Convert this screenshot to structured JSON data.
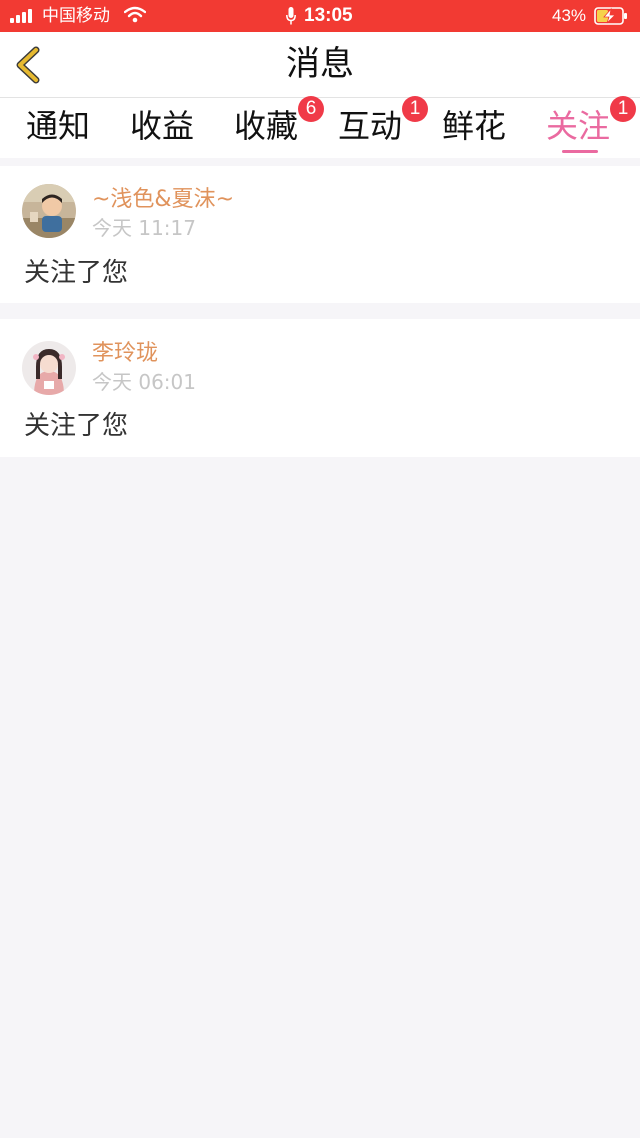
{
  "status_bar": {
    "carrier": "中国移动",
    "time": "13:05",
    "battery": "43%"
  },
  "nav": {
    "title": "消息"
  },
  "tabs": [
    {
      "label": "通知",
      "badge": ""
    },
    {
      "label": "收益",
      "badge": ""
    },
    {
      "label": "收藏",
      "badge": "6"
    },
    {
      "label": "互动",
      "badge": "1"
    },
    {
      "label": "鲜花",
      "badge": ""
    },
    {
      "label": "关注",
      "badge": "1",
      "active": true
    }
  ],
  "notifications": [
    {
      "username": "~浅色&夏沫~",
      "time": "今天 11:17",
      "message": "关注了您"
    },
    {
      "username": "李玲珑",
      "time": "今天 06:01",
      "message": "关注了您"
    }
  ],
  "colors": {
    "status_bar": "#f23a33",
    "accent": "#ea6aa0",
    "username": "#e0935c",
    "badge": "#f03a48",
    "back_arrow": "#e6b930"
  }
}
